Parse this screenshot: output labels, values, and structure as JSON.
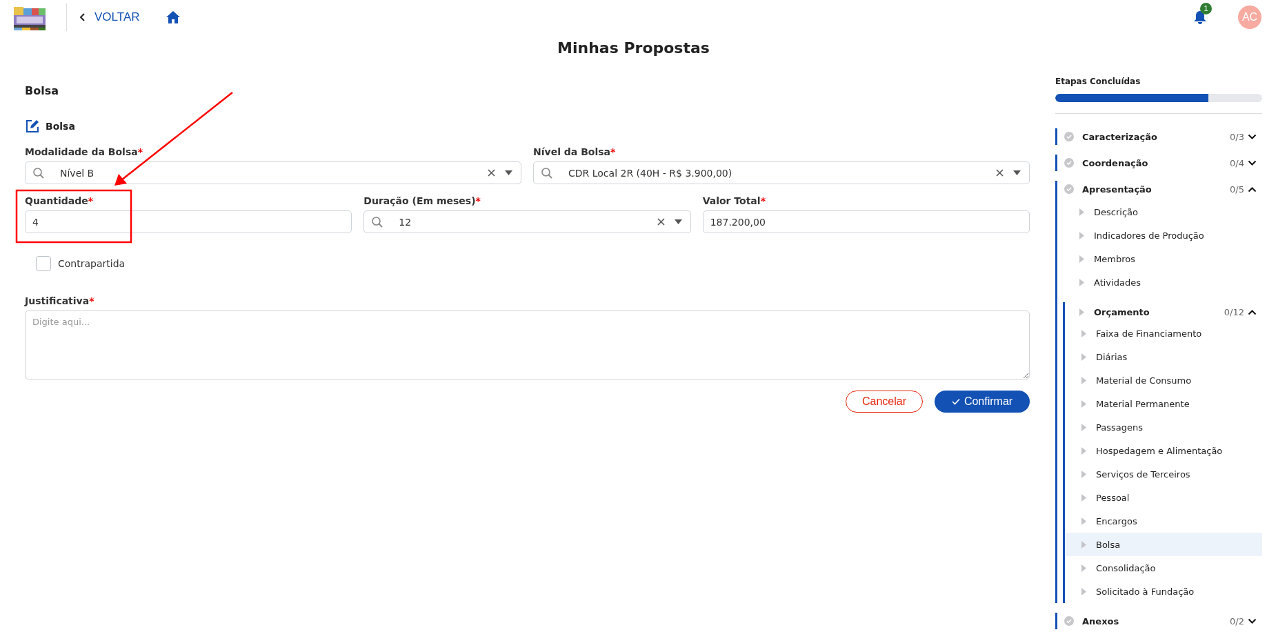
{
  "header": {
    "back_label": "VOLTAR",
    "notifications": {
      "count": "1"
    },
    "avatar": {
      "initials": "AC"
    }
  },
  "page_title": "Minhas Propostas",
  "form": {
    "section_title": "Bolsa",
    "subtitle": "Bolsa",
    "rows": [
      [
        {
          "label": "Modalidade da Bolsa",
          "required_mark": "*",
          "kind": "select",
          "value": "Nível B"
        },
        {
          "label": "Nível da Bolsa",
          "required_mark": "*",
          "kind": "select",
          "value": "CDR Local 2R (40H - R$ 3.900,00)"
        }
      ],
      [
        {
          "label": "Quantidade",
          "required_mark": "*",
          "kind": "text",
          "value": "4"
        },
        {
          "label": "Duração (Em meses)",
          "required_mark": "*",
          "kind": "select",
          "value": "12"
        },
        {
          "label": "Valor Total",
          "required_mark": "*",
          "kind": "text",
          "value": "187.200,00"
        }
      ]
    ],
    "checkbox": {
      "label": "Contrapartida",
      "checked": false
    },
    "justificativa": {
      "label": "Justificativa",
      "required_mark": "*",
      "placeholder": "Digite aqui..."
    },
    "buttons": [
      {
        "label": "Cancelar",
        "kind": "secondary"
      },
      {
        "label": "Confirmar",
        "kind": "primary"
      }
    ]
  },
  "sidebar": {
    "progress": {
      "label": "Etapas Concluídas",
      "level": 0.74
    },
    "sections": [
      {
        "label": "Caracterização",
        "count": "0/3",
        "expanded": false
      },
      {
        "label": "Coordenação",
        "count": "0/4",
        "expanded": false
      },
      {
        "label": "Apresentação",
        "count": "0/5",
        "expanded": true,
        "children": [
          {
            "label": "Descrição",
            "selected": false
          },
          {
            "label": "Indicadores de Produção",
            "selected": false
          },
          {
            "label": "Membros",
            "selected": false
          },
          {
            "label": "Atividades",
            "selected": false
          },
          {
            "label": "Orçamento",
            "count": "0/12",
            "expanded": true,
            "selected": false,
            "children": [
              {
                "label": "Faixa de Financiamento",
                "selected": false
              },
              {
                "label": "Diárias",
                "selected": false
              },
              {
                "label": "Material de Consumo",
                "selected": false
              },
              {
                "label": "Material Permanente",
                "selected": false
              },
              {
                "label": "Passagens",
                "selected": false
              },
              {
                "label": "Hospedagem e Alimentação",
                "selected": false
              },
              {
                "label": "Serviços de Terceiros",
                "selected": false
              },
              {
                "label": "Pessoal",
                "selected": false
              },
              {
                "label": "Encargos",
                "selected": false
              },
              {
                "label": "Bolsa",
                "selected": true
              },
              {
                "label": "Consolidação",
                "selected": false
              },
              {
                "label": "Solicitado à Fundação",
                "selected": false
              }
            ]
          }
        ]
      },
      {
        "label": "Anexos",
        "count": "0/2",
        "expanded": false
      }
    ]
  }
}
